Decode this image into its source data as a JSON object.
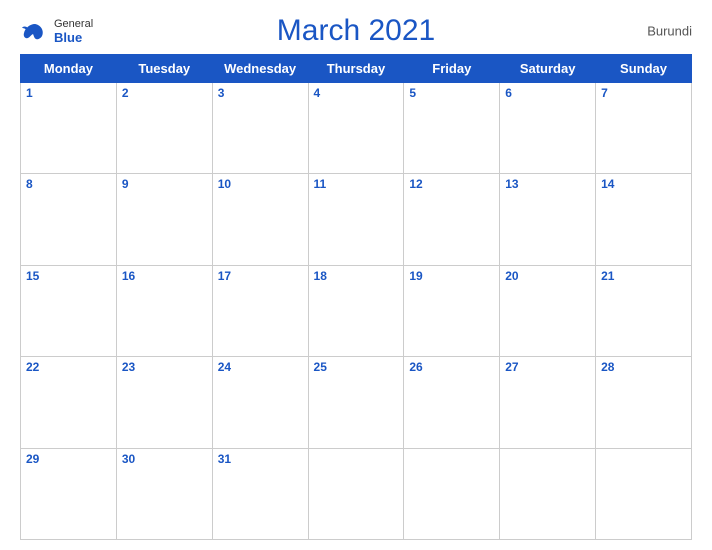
{
  "header": {
    "title": "March 2021",
    "country": "Burundi",
    "logo": {
      "general": "General",
      "blue": "Blue"
    }
  },
  "weekdays": [
    "Monday",
    "Tuesday",
    "Wednesday",
    "Thursday",
    "Friday",
    "Saturday",
    "Sunday"
  ],
  "weeks": [
    [
      "1",
      "2",
      "3",
      "4",
      "5",
      "6",
      "7"
    ],
    [
      "8",
      "9",
      "10",
      "11",
      "12",
      "13",
      "14"
    ],
    [
      "15",
      "16",
      "17",
      "18",
      "19",
      "20",
      "21"
    ],
    [
      "22",
      "23",
      "24",
      "25",
      "26",
      "27",
      "28"
    ],
    [
      "29",
      "30",
      "31",
      "",
      "",
      "",
      ""
    ]
  ],
  "colors": {
    "header_bg": "#1a56c4",
    "header_text": "#ffffff",
    "day_num": "#1a56c4",
    "border": "#cccccc",
    "title": "#1a56c4"
  }
}
